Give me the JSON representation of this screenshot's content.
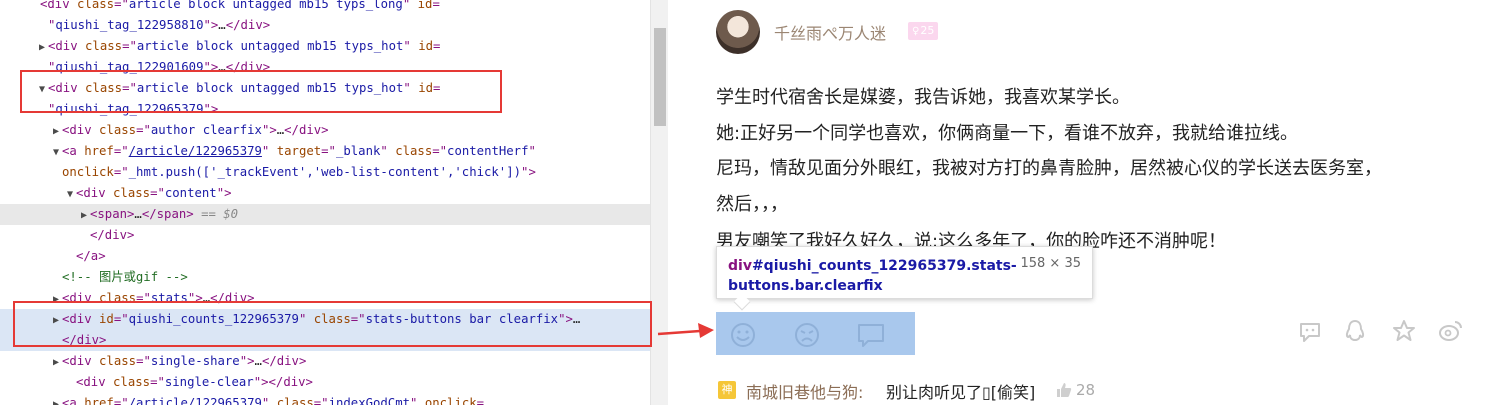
{
  "devtools": {
    "rows": [
      {
        "indent": 28,
        "tri": "",
        "cls": "",
        "html": "<span class=\"tk\">&lt;div</span> <span class=\"an\">class</span>=\"<span class=\"av\">article block untagged mb15 typs_long</span>\" <span class=\"an\">id</span>="
      },
      {
        "indent": 36,
        "tri": "",
        "cls": "",
        "html": "\"<span class=\"av\">qiushi_tag_122958810</span>\"<span class=\"tk\">&gt;</span><span class=\"tx\">…</span><span class=\"tk\">&lt;/div&gt;</span>"
      },
      {
        "indent": 36,
        "tri": "▶",
        "cls": "",
        "html": "<span class=\"tk\">&lt;div</span> <span class=\"an\">class</span>=\"<span class=\"av\">article block untagged mb15 typs_hot</span>\" <span class=\"an\">id</span>="
      },
      {
        "indent": 36,
        "tri": "",
        "cls": "",
        "html": "\"<span class=\"av\">qiushi_tag_122901609</span>\"<span class=\"tk\">&gt;</span><span class=\"tx\">…</span><span class=\"tk\">&lt;/div&gt;</span>"
      },
      {
        "indent": 36,
        "tri": "▼",
        "cls": "",
        "html": "<span class=\"tk\">&lt;div</span> <span class=\"an\">class</span>=\"<span class=\"av\">article block untagged mb15 typs_hot</span>\" <span class=\"an\">id</span>="
      },
      {
        "indent": 36,
        "tri": "",
        "cls": "",
        "html": "\"<span class=\"av\">qiushi_tag_122965379</span>\"<span class=\"tk\">&gt;</span>"
      },
      {
        "indent": 50,
        "tri": "▶",
        "cls": "",
        "html": "<span class=\"tk\">&lt;div</span> <span class=\"an\">class</span>=\"<span class=\"av\">author clearfix</span>\"<span class=\"tk\">&gt;</span><span class=\"tx\">…</span><span class=\"tk\">&lt;/div&gt;</span>"
      },
      {
        "indent": 50,
        "tri": "▼",
        "cls": "",
        "html": "<span class=\"tk\">&lt;a</span> <span class=\"an\">href</span>=\"<span class=\"av\"><span class=\"lnk\">/article/122965379</span></span>\" <span class=\"an\">target</span>=\"<span class=\"av\">_blank</span>\" <span class=\"an\">class</span>=\"<span class=\"av\">contentHerf</span>\""
      },
      {
        "indent": 50,
        "tri": "",
        "cls": "",
        "html": "<span class=\"an\">onclick</span>=\"<span class=\"av\">_hmt.push(['_trackEvent','web-list-content','chick'])</span>\"<span class=\"tk\">&gt;</span>"
      },
      {
        "indent": 64,
        "tri": "▼",
        "cls": "",
        "html": "<span class=\"tk\">&lt;div</span> <span class=\"an\">class</span>=\"<span class=\"av\">content</span>\"<span class=\"tk\">&gt;</span>"
      },
      {
        "indent": 78,
        "tri": "▶",
        "cls": "sel",
        "html": "<span class=\"tk\">&lt;span&gt;</span><span class=\"tx\">…</span><span class=\"tk\">&lt;/span&gt;</span> <span class=\"dimv\">== $0</span>"
      },
      {
        "indent": 78,
        "tri": "",
        "cls": "",
        "html": "<span class=\"tk\">&lt;/div&gt;</span>"
      },
      {
        "indent": 64,
        "tri": "",
        "cls": "",
        "html": "<span class=\"tk\">&lt;/a&gt;</span>"
      },
      {
        "indent": 50,
        "tri": "",
        "cls": "",
        "html": "<span class=\"cm\">&lt;!-- 图片或gif --&gt;</span>"
      },
      {
        "indent": 50,
        "tri": "▶",
        "cls": "",
        "html": "<span class=\"tk\">&lt;div</span> <span class=\"an\">class</span>=\"<span class=\"av\">stats</span>\"<span class=\"tk\">&gt;</span><span class=\"tx\">…</span><span class=\"tk\">&lt;/div&gt;</span>"
      },
      {
        "indent": 50,
        "tri": "▶",
        "cls": "hover",
        "html": "<span class=\"tk\">&lt;div</span> <span class=\"an\">id</span>=\"<span class=\"av\">qiushi_counts_122965379</span>\" <span class=\"an\">class</span>=\"<span class=\"av\">stats-buttons bar clearfix</span>\"<span class=\"tk\">&gt;</span><span class=\"tx\">…</span>"
      },
      {
        "indent": 50,
        "tri": "",
        "cls": "hover",
        "html": "<span class=\"tk\">&lt;/div&gt;</span>"
      },
      {
        "indent": 50,
        "tri": "▶",
        "cls": "",
        "html": "<span class=\"tk\">&lt;div</span> <span class=\"an\">class</span>=\"<span class=\"av\">single-share</span>\"<span class=\"tk\">&gt;</span><span class=\"tx\">…</span><span class=\"tk\">&lt;/div&gt;</span>"
      },
      {
        "indent": 64,
        "tri": "",
        "cls": "",
        "html": "<span class=\"tk\">&lt;div</span> <span class=\"an\">class</span>=\"<span class=\"av\">single-clear</span>\"<span class=\"tk\">&gt;&lt;/div&gt;</span>"
      },
      {
        "indent": 50,
        "tri": "▶",
        "cls": "",
        "html": "<span class=\"tk\">&lt;a</span> <span class=\"an\">href</span>=\"<span class=\"av\"><span class=\"lnk\">/article/122965379</span></span>\" <span class=\"an\">class</span>=\"<span class=\"av\">indexGodCmt</span>\" <span class=\"an\">onclick</span>="
      }
    ]
  },
  "article": {
    "author": {
      "name": "千丝雨ぺ万人迷",
      "badge_symbol": "♀",
      "badge_level": "25"
    },
    "content_lines": [
      "学生时代宿舍长是媒婆，我告诉她，我喜欢某学长。",
      "她:正好另一个同学也喜欢，你俩商量一下，看谁不放弃，我就给谁拉线。",
      "尼玛，情敌见面分外眼红，我被对方打的鼻青脸肿，居然被心仪的学长送去医务室，",
      "然后，，，",
      "男友嘲笑了我好久好久，说:这么多年了，你的脸咋还不消肿呢！"
    ],
    "tooltip": {
      "tag": "div",
      "selector": "#qiushi_counts_122965379.stats-buttons.bar.clearfix",
      "size": "158 × 35"
    },
    "stat_icons": [
      "smile-face-icon",
      "sad-face-icon",
      "comment-bubble-icon"
    ],
    "share_icons": [
      "wechat-icon",
      "qq-icon",
      "qzone-star-icon",
      "weibo-icon"
    ],
    "god_comment": {
      "badge": "神",
      "user": "南城旧巷他与狗:",
      "text": "别让肉听见了▯[偷笑]",
      "like_icon": "thumb-up-icon",
      "likes": "28"
    }
  }
}
